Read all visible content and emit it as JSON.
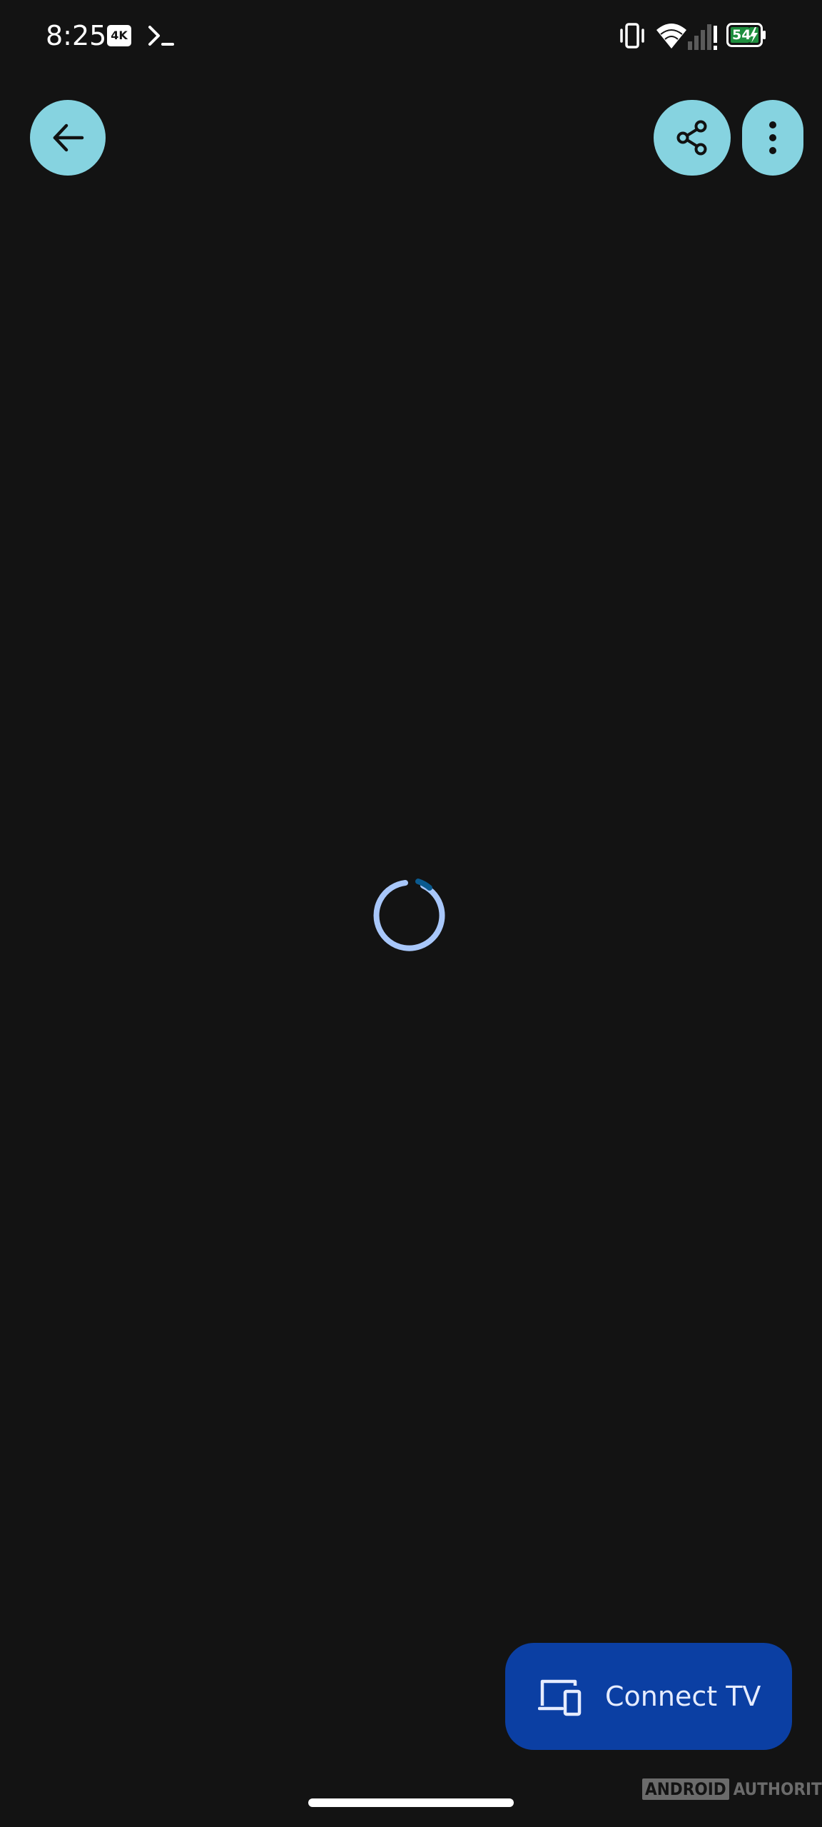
{
  "status_bar": {
    "time": "8:25",
    "badge_4k": "4K",
    "battery_level": "54",
    "icons": [
      "terminal-icon",
      "vibrate-icon",
      "wifi-icon",
      "signal-alert-icon",
      "battery-charging-icon"
    ]
  },
  "top_bar": {
    "back_icon": "arrow-back-icon",
    "share_icon": "share-icon",
    "more_icon": "more-vert-icon"
  },
  "loading": {
    "icon": "loading-spinner-icon"
  },
  "connect_tv": {
    "label": "Connect TV",
    "icon": "devices-icon"
  },
  "watermark": {
    "boxed": "ANDROID",
    "text": "AUTHORITY"
  },
  "colors": {
    "background": "#131313",
    "round_button": "#86d3e0",
    "connect_button": "#0b3fa3",
    "spinner": "#a8c7fa",
    "spinner_accent": "#0a5a8f",
    "battery_fill": "#1e8e3e"
  }
}
